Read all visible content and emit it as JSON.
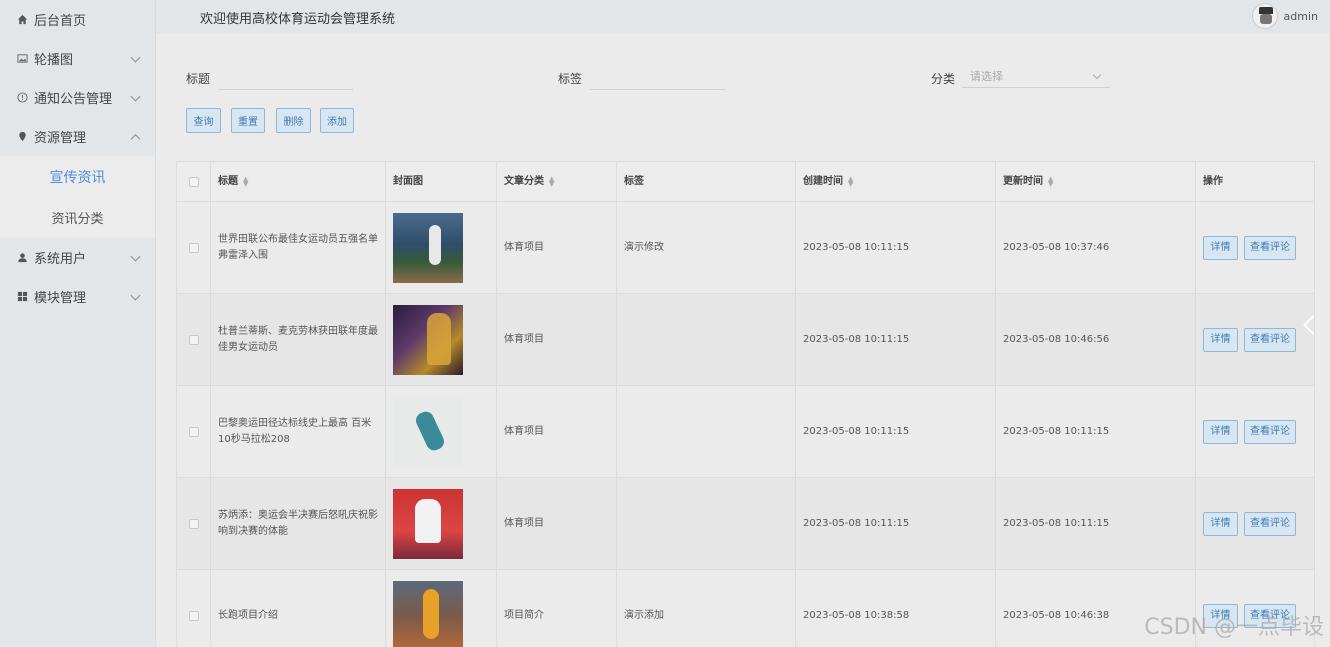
{
  "sidebar": {
    "items": [
      {
        "label": "后台首页",
        "icon": "home-icon"
      },
      {
        "label": "轮播图",
        "icon": "image-icon"
      },
      {
        "label": "通知公告管理",
        "icon": "info-icon"
      },
      {
        "label": "资源管理",
        "icon": "location-pin-icon",
        "expanded": true,
        "children": [
          {
            "label": "宣传资讯",
            "active": true
          },
          {
            "label": "资讯分类"
          }
        ]
      },
      {
        "label": "系统用户",
        "icon": "user-icon"
      },
      {
        "label": "模块管理",
        "icon": "grid-icon"
      }
    ]
  },
  "header": {
    "title": "欢迎使用高校体育运动会管理系统",
    "username": "admin"
  },
  "filters": {
    "title_label": "标题",
    "tag_label": "标签",
    "category_label": "分类",
    "category_placeholder": "请选择"
  },
  "buttons": {
    "query": "查询",
    "reset": "重置",
    "delete": "删除",
    "add": "添加"
  },
  "table": {
    "columns": [
      "标题",
      "封面图",
      "文章分类",
      "标签",
      "创建时间",
      "更新时间",
      "操作"
    ],
    "rows": [
      {
        "title": "世界田联公布最佳女运动员五强名单 弗雷泽入围",
        "category": "体育项目",
        "tag": "演示修改",
        "created": "2023-05-08 10:11:15",
        "updated": "2023-05-08 10:37:46"
      },
      {
        "title": "杜普兰蒂斯、麦克劳林获田联年度最佳男女运动员",
        "category": "体育项目",
        "tag": "",
        "created": "2023-05-08 10:11:15",
        "updated": "2023-05-08 10:46:56"
      },
      {
        "title": "巴黎奥运田径达标线史上最高 百米10秒马拉松208",
        "category": "体育项目",
        "tag": "",
        "created": "2023-05-08 10:11:15",
        "updated": "2023-05-08 10:11:15"
      },
      {
        "title": "苏炳添：奥运会半决赛后怒吼庆祝影响到决赛的体能",
        "category": "体育项目",
        "tag": "",
        "created": "2023-05-08 10:11:15",
        "updated": "2023-05-08 10:11:15"
      },
      {
        "title": "长跑项目介绍",
        "category": "项目简介",
        "tag": "演示添加",
        "created": "2023-05-08 10:38:58",
        "updated": "2023-05-08 10:46:38"
      }
    ],
    "actions": {
      "detail": "详情",
      "comments": "查看评论"
    }
  },
  "watermark": "CSDN @一点毕设"
}
